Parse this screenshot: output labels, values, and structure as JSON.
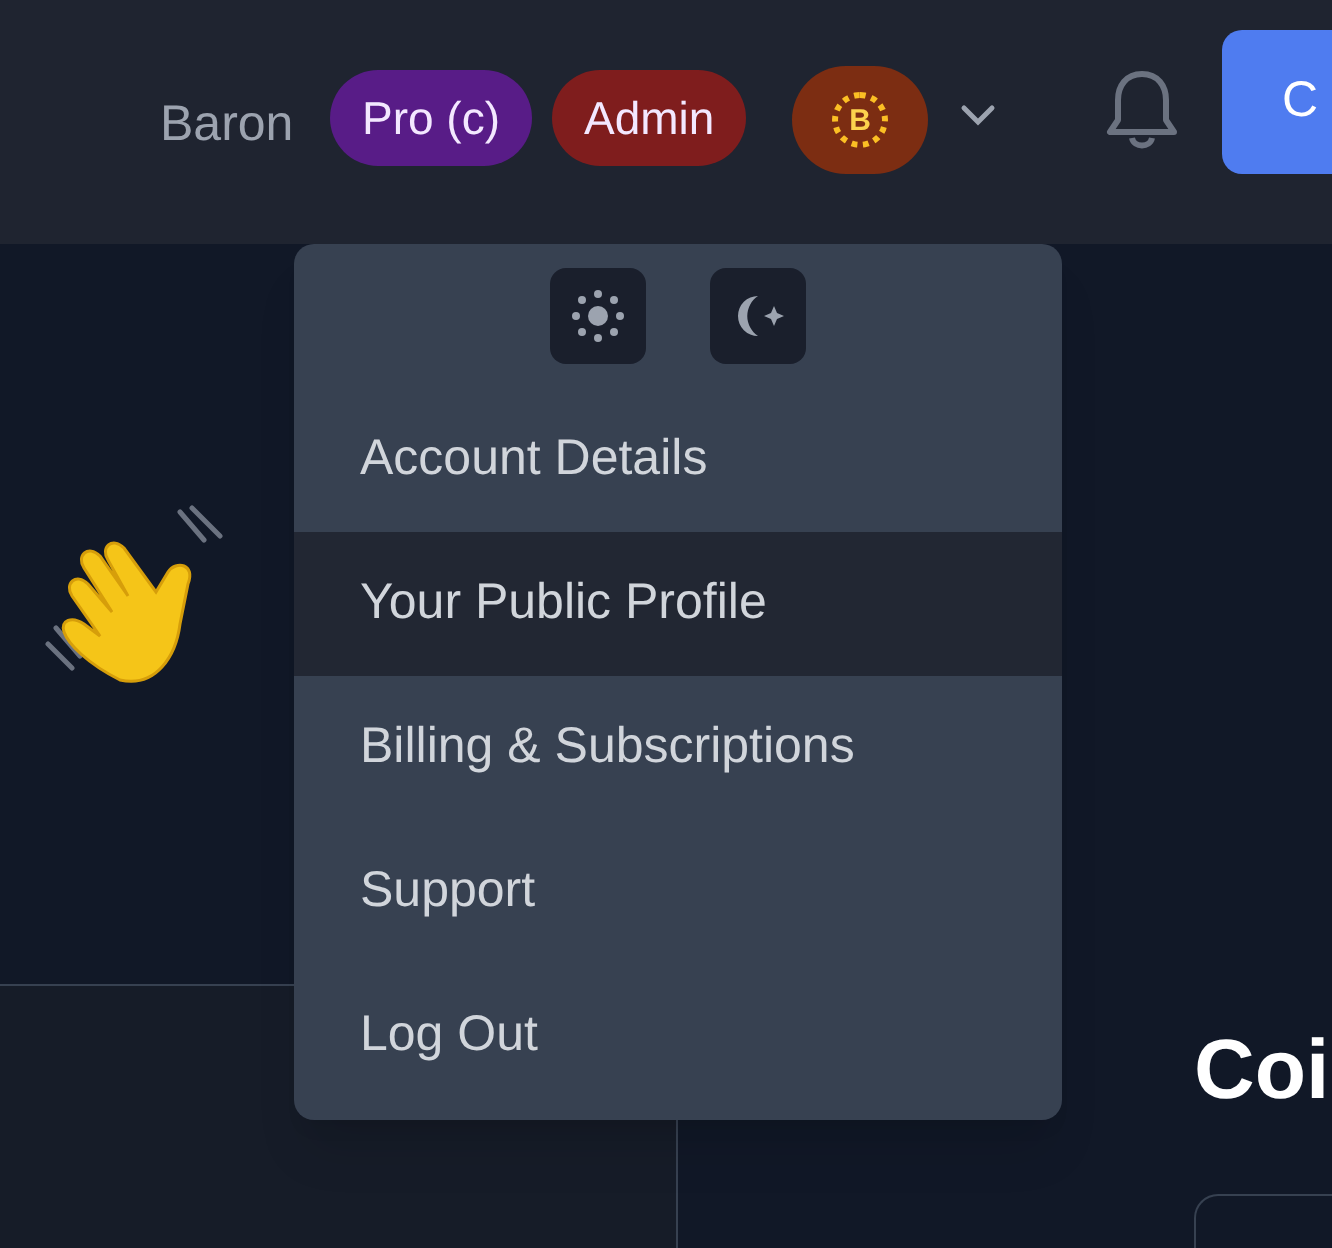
{
  "header": {
    "username": "Baron",
    "badges": [
      {
        "label": "Pro (c)",
        "color": "#581c87"
      },
      {
        "label": "Admin",
        "color": "#7f1d1d"
      }
    ],
    "coin_badge": {
      "label": "B"
    },
    "create_button": {
      "label": "C"
    }
  },
  "user_menu": {
    "items": [
      {
        "label": "Account Details",
        "selected": false
      },
      {
        "label": "Your Public Profile",
        "selected": true
      },
      {
        "label": "Billing & Subscriptions",
        "selected": false
      },
      {
        "label": "Support",
        "selected": false
      },
      {
        "label": "Log Out",
        "selected": false
      }
    ]
  },
  "main": {
    "heading": "Coi"
  }
}
